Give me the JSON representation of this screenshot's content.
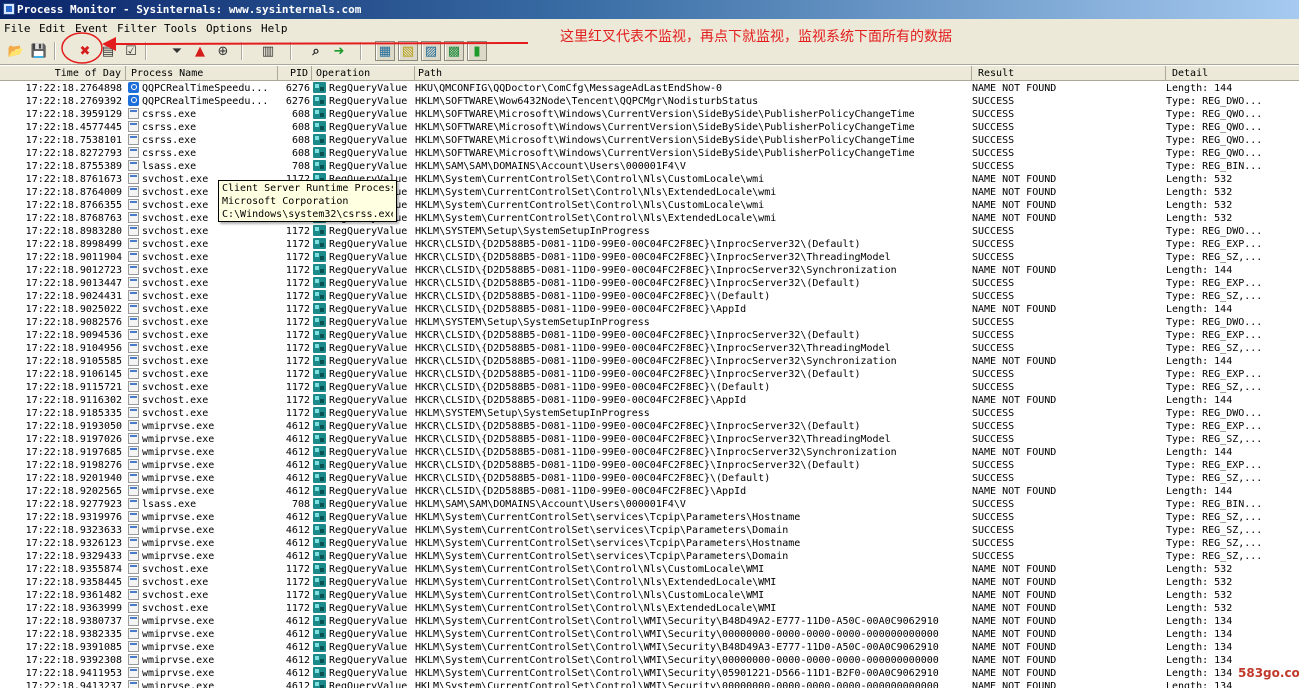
{
  "window": {
    "title": "Process Monitor - Sysinternals: www.sysinternals.com"
  },
  "menu": [
    "File",
    "Edit",
    "Event",
    "Filter",
    "Tools",
    "Options",
    "Help"
  ],
  "toolbar": {
    "buttons": [
      {
        "name": "open-icon",
        "glyph": "📂"
      },
      {
        "name": "save-icon",
        "glyph": "💾"
      },
      {
        "name": "capture-icon",
        "glyph": "✖"
      },
      {
        "name": "autoscroll-icon",
        "glyph": "▤"
      },
      {
        "name": "clear-icon",
        "glyph": "☑"
      },
      {
        "name": "filter-icon",
        "glyph": "⏷"
      },
      {
        "name": "highlight-icon",
        "glyph": "▲"
      },
      {
        "name": "network-icon",
        "glyph": "⊕"
      },
      {
        "name": "properties-icon",
        "glyph": "▥"
      },
      {
        "name": "find-icon",
        "glyph": "⌕"
      },
      {
        "name": "jump-icon",
        "glyph": "➜"
      },
      {
        "name": "registry-activity-icon",
        "glyph": "▦"
      },
      {
        "name": "file-activity-icon",
        "glyph": "▧"
      },
      {
        "name": "network-activity-icon",
        "glyph": "▨"
      },
      {
        "name": "process-activity-icon",
        "glyph": "▩"
      },
      {
        "name": "profiling-activity-icon",
        "glyph": "▮"
      }
    ]
  },
  "annotation": {
    "text": "这里红叉代表不监视，再点下就监视，监视系统下面所有的数据",
    "color": "#e31d1d"
  },
  "columns": {
    "time": "Time of Day",
    "process": "Process Name",
    "pid": "PID",
    "operation": "Operation",
    "path": "Path",
    "result": "Result",
    "detail": "Detail"
  },
  "rows": [
    {
      "time": "17:22:18.2764898",
      "proc": "QQPCRealTimeSpeedu...",
      "icon": "qq",
      "pid": "6276",
      "op": "RegQueryValue",
      "path": "HKU\\QMCONFIG\\QQDoctor\\ComCfg\\MessageAdLastEndShow-0",
      "result": "NAME NOT FOUND",
      "detail": "Length: 144"
    },
    {
      "time": "17:22:18.2769392",
      "proc": "QQPCRealTimeSpeedu...",
      "icon": "qq",
      "pid": "6276",
      "op": "RegQueryValue",
      "path": "HKLM\\SOFTWARE\\Wow6432Node\\Tencent\\QQPCMgr\\NodisturbStatus",
      "result": "SUCCESS",
      "detail": "Type: REG_DWO..."
    },
    {
      "time": "17:22:18.3959129",
      "proc": "csrss.exe",
      "icon": "gen",
      "pid": "608",
      "op": "RegQueryValue",
      "path": "HKLM\\SOFTWARE\\Microsoft\\Windows\\CurrentVersion\\SideBySide\\PublisherPolicyChangeTime",
      "result": "SUCCESS",
      "detail": "Type: REG_QWO..."
    },
    {
      "time": "17:22:18.4577445",
      "proc": "csrss.exe",
      "icon": "gen",
      "pid": "608",
      "op": "RegQueryValue",
      "path": "HKLM\\SOFTWARE\\Microsoft\\Windows\\CurrentVersion\\SideBySide\\PublisherPolicyChangeTime",
      "result": "SUCCESS",
      "detail": "Type: REG_QWO..."
    },
    {
      "time": "17:22:18.7538101",
      "proc": "csrss.exe",
      "icon": "gen",
      "pid": "608",
      "op": "RegQueryValue",
      "path": "HKLM\\SOFTWARE\\Microsoft\\Windows\\CurrentVersion\\SideBySide\\PublisherPolicyChangeTime",
      "result": "SUCCESS",
      "detail": "Type: REG_QWO..."
    },
    {
      "time": "17:22:18.8272793",
      "proc": "csrss.exe",
      "icon": "gen",
      "pid": "608",
      "op": "RegQueryValue",
      "path": "HKLM\\SOFTWARE\\Microsoft\\Windows\\CurrentVersion\\SideBySide\\PublisherPolicyChangeTime",
      "result": "SUCCESS",
      "detail": "Type: REG_QWO..."
    },
    {
      "time": "17:22:18.8755389",
      "proc": "lsass.exe",
      "icon": "gen",
      "pid": "708",
      "op": "RegQueryValue",
      "path": "HKLM\\SAM\\SAM\\DOMAINS\\Account\\Users\\000001F4\\V",
      "result": "SUCCESS",
      "detail": "Type: REG_BIN..."
    },
    {
      "time": "17:22:18.8761673",
      "proc": "svchost.exe",
      "icon": "gen",
      "pid": "1172",
      "op": "RegQueryValue",
      "path": "HKLM\\System\\CurrentControlSet\\Control\\Nls\\CustomLocale\\wmi",
      "result": "NAME NOT FOUND",
      "detail": "Length: 532"
    },
    {
      "time": "17:22:18.8764009",
      "proc": "svchost.exe",
      "icon": "gen",
      "pid": "1172",
      "op": "RegQueryValue",
      "path": "HKLM\\System\\CurrentControlSet\\Control\\Nls\\ExtendedLocale\\wmi",
      "result": "NAME NOT FOUND",
      "detail": "Length: 532"
    },
    {
      "time": "17:22:18.8766355",
      "proc": "svchost.exe",
      "icon": "gen",
      "pid": "1172",
      "op": "RegQueryValue",
      "path": "HKLM\\System\\CurrentControlSet\\Control\\Nls\\CustomLocale\\wmi",
      "result": "NAME NOT FOUND",
      "detail": "Length: 532"
    },
    {
      "time": "17:22:18.8768763",
      "proc": "svchost.exe",
      "icon": "gen",
      "pid": "1172",
      "op": "RegQueryValue",
      "path": "HKLM\\System\\CurrentControlSet\\Control\\Nls\\ExtendedLocale\\wmi",
      "result": "NAME NOT FOUND",
      "detail": "Length: 532"
    },
    {
      "time": "17:22:18.8983280",
      "proc": "svchost.exe",
      "icon": "gen",
      "pid": "1172",
      "op": "RegQueryValue",
      "path": "HKLM\\SYSTEM\\Setup\\SystemSetupInProgress",
      "result": "SUCCESS",
      "detail": "Type: REG_DWO..."
    },
    {
      "time": "17:22:18.8998499",
      "proc": "svchost.exe",
      "icon": "gen",
      "pid": "1172",
      "op": "RegQueryValue",
      "path": "HKCR\\CLSID\\{D2D588B5-D081-11D0-99E0-00C04FC2F8EC}\\InprocServer32\\(Default)",
      "result": "SUCCESS",
      "detail": "Type: REG_EXP..."
    },
    {
      "time": "17:22:18.9011904",
      "proc": "svchost.exe",
      "icon": "gen",
      "pid": "1172",
      "op": "RegQueryValue",
      "path": "HKCR\\CLSID\\{D2D588B5-D081-11D0-99E0-00C04FC2F8EC}\\InprocServer32\\ThreadingModel",
      "result": "SUCCESS",
      "detail": "Type: REG_SZ,..."
    },
    {
      "time": "17:22:18.9012723",
      "proc": "svchost.exe",
      "icon": "gen",
      "pid": "1172",
      "op": "RegQueryValue",
      "path": "HKCR\\CLSID\\{D2D588B5-D081-11D0-99E0-00C04FC2F8EC}\\InprocServer32\\Synchronization",
      "result": "NAME NOT FOUND",
      "detail": "Length: 144"
    },
    {
      "time": "17:22:18.9013447",
      "proc": "svchost.exe",
      "icon": "gen",
      "pid": "1172",
      "op": "RegQueryValue",
      "path": "HKCR\\CLSID\\{D2D588B5-D081-11D0-99E0-00C04FC2F8EC}\\InprocServer32\\(Default)",
      "result": "SUCCESS",
      "detail": "Type: REG_EXP..."
    },
    {
      "time": "17:22:18.9024431",
      "proc": "svchost.exe",
      "icon": "gen",
      "pid": "1172",
      "op": "RegQueryValue",
      "path": "HKCR\\CLSID\\{D2D588B5-D081-11D0-99E0-00C04FC2F8EC}\\(Default)",
      "result": "SUCCESS",
      "detail": "Type: REG_SZ,..."
    },
    {
      "time": "17:22:18.9025022",
      "proc": "svchost.exe",
      "icon": "gen",
      "pid": "1172",
      "op": "RegQueryValue",
      "path": "HKCR\\CLSID\\{D2D588B5-D081-11D0-99E0-00C04FC2F8EC}\\AppId",
      "result": "NAME NOT FOUND",
      "detail": "Length: 144"
    },
    {
      "time": "17:22:18.9082576",
      "proc": "svchost.exe",
      "icon": "gen",
      "pid": "1172",
      "op": "RegQueryValue",
      "path": "HKLM\\SYSTEM\\Setup\\SystemSetupInProgress",
      "result": "SUCCESS",
      "detail": "Type: REG_DWO..."
    },
    {
      "time": "17:22:18.9094536",
      "proc": "svchost.exe",
      "icon": "gen",
      "pid": "1172",
      "op": "RegQueryValue",
      "path": "HKCR\\CLSID\\{D2D588B5-D081-11D0-99E0-00C04FC2F8EC}\\InprocServer32\\(Default)",
      "result": "SUCCESS",
      "detail": "Type: REG_EXP..."
    },
    {
      "time": "17:22:18.9104956",
      "proc": "svchost.exe",
      "icon": "gen",
      "pid": "1172",
      "op": "RegQueryValue",
      "path": "HKCR\\CLSID\\{D2D588B5-D081-11D0-99E0-00C04FC2F8EC}\\InprocServer32\\ThreadingModel",
      "result": "SUCCESS",
      "detail": "Type: REG_SZ,..."
    },
    {
      "time": "17:22:18.9105585",
      "proc": "svchost.exe",
      "icon": "gen",
      "pid": "1172",
      "op": "RegQueryValue",
      "path": "HKCR\\CLSID\\{D2D588B5-D081-11D0-99E0-00C04FC2F8EC}\\InprocServer32\\Synchronization",
      "result": "NAME NOT FOUND",
      "detail": "Length: 144"
    },
    {
      "time": "17:22:18.9106145",
      "proc": "svchost.exe",
      "icon": "gen",
      "pid": "1172",
      "op": "RegQueryValue",
      "path": "HKCR\\CLSID\\{D2D588B5-D081-11D0-99E0-00C04FC2F8EC}\\InprocServer32\\(Default)",
      "result": "SUCCESS",
      "detail": "Type: REG_EXP..."
    },
    {
      "time": "17:22:18.9115721",
      "proc": "svchost.exe",
      "icon": "gen",
      "pid": "1172",
      "op": "RegQueryValue",
      "path": "HKCR\\CLSID\\{D2D588B5-D081-11D0-99E0-00C04FC2F8EC}\\(Default)",
      "result": "SUCCESS",
      "detail": "Type: REG_SZ,..."
    },
    {
      "time": "17:22:18.9116302",
      "proc": "svchost.exe",
      "icon": "gen",
      "pid": "1172",
      "op": "RegQueryValue",
      "path": "HKCR\\CLSID\\{D2D588B5-D081-11D0-99E0-00C04FC2F8EC}\\AppId",
      "result": "NAME NOT FOUND",
      "detail": "Length: 144"
    },
    {
      "time": "17:22:18.9185335",
      "proc": "svchost.exe",
      "icon": "gen",
      "pid": "1172",
      "op": "RegQueryValue",
      "path": "HKLM\\SYSTEM\\Setup\\SystemSetupInProgress",
      "result": "SUCCESS",
      "detail": "Type: REG_DWO..."
    },
    {
      "time": "17:22:18.9193050",
      "proc": "wmiprvse.exe",
      "icon": "gen",
      "pid": "4612",
      "op": "RegQueryValue",
      "path": "HKCR\\CLSID\\{D2D588B5-D081-11D0-99E0-00C04FC2F8EC}\\InprocServer32\\(Default)",
      "result": "SUCCESS",
      "detail": "Type: REG_EXP..."
    },
    {
      "time": "17:22:18.9197026",
      "proc": "wmiprvse.exe",
      "icon": "gen",
      "pid": "4612",
      "op": "RegQueryValue",
      "path": "HKCR\\CLSID\\{D2D588B5-D081-11D0-99E0-00C04FC2F8EC}\\InprocServer32\\ThreadingModel",
      "result": "SUCCESS",
      "detail": "Type: REG_SZ,..."
    },
    {
      "time": "17:22:18.9197685",
      "proc": "wmiprvse.exe",
      "icon": "gen",
      "pid": "4612",
      "op": "RegQueryValue",
      "path": "HKCR\\CLSID\\{D2D588B5-D081-11D0-99E0-00C04FC2F8EC}\\InprocServer32\\Synchronization",
      "result": "NAME NOT FOUND",
      "detail": "Length: 144"
    },
    {
      "time": "17:22:18.9198276",
      "proc": "wmiprvse.exe",
      "icon": "gen",
      "pid": "4612",
      "op": "RegQueryValue",
      "path": "HKCR\\CLSID\\{D2D588B5-D081-11D0-99E0-00C04FC2F8EC}\\InprocServer32\\(Default)",
      "result": "SUCCESS",
      "detail": "Type: REG_EXP..."
    },
    {
      "time": "17:22:18.9201940",
      "proc": "wmiprvse.exe",
      "icon": "gen",
      "pid": "4612",
      "op": "RegQueryValue",
      "path": "HKCR\\CLSID\\{D2D588B5-D081-11D0-99E0-00C04FC2F8EC}\\(Default)",
      "result": "SUCCESS",
      "detail": "Type: REG_SZ,..."
    },
    {
      "time": "17:22:18.9202565",
      "proc": "wmiprvse.exe",
      "icon": "gen",
      "pid": "4612",
      "op": "RegQueryValue",
      "path": "HKCR\\CLSID\\{D2D588B5-D081-11D0-99E0-00C04FC2F8EC}\\AppId",
      "result": "NAME NOT FOUND",
      "detail": "Length: 144"
    },
    {
      "time": "17:22:18.9277923",
      "proc": "lsass.exe",
      "icon": "gen",
      "pid": "708",
      "op": "RegQueryValue",
      "path": "HKLM\\SAM\\SAM\\DOMAINS\\Account\\Users\\000001F4\\V",
      "result": "SUCCESS",
      "detail": "Type: REG_BIN..."
    },
    {
      "time": "17:22:18.9319976",
      "proc": "wmiprvse.exe",
      "icon": "gen",
      "pid": "4612",
      "op": "RegQueryValue",
      "path": "HKLM\\System\\CurrentControlSet\\services\\Tcpip\\Parameters\\Hostname",
      "result": "SUCCESS",
      "detail": "Type: REG_SZ,..."
    },
    {
      "time": "17:22:18.9323633",
      "proc": "wmiprvse.exe",
      "icon": "gen",
      "pid": "4612",
      "op": "RegQueryValue",
      "path": "HKLM\\System\\CurrentControlSet\\services\\Tcpip\\Parameters\\Domain",
      "result": "SUCCESS",
      "detail": "Type: REG_SZ,..."
    },
    {
      "time": "17:22:18.9326123",
      "proc": "wmiprvse.exe",
      "icon": "gen",
      "pid": "4612",
      "op": "RegQueryValue",
      "path": "HKLM\\System\\CurrentControlSet\\services\\Tcpip\\Parameters\\Hostname",
      "result": "SUCCESS",
      "detail": "Type: REG_SZ,..."
    },
    {
      "time": "17:22:18.9329433",
      "proc": "wmiprvse.exe",
      "icon": "gen",
      "pid": "4612",
      "op": "RegQueryValue",
      "path": "HKLM\\System\\CurrentControlSet\\services\\Tcpip\\Parameters\\Domain",
      "result": "SUCCESS",
      "detail": "Type: REG_SZ,..."
    },
    {
      "time": "17:22:18.9355874",
      "proc": "svchost.exe",
      "icon": "gen",
      "pid": "1172",
      "op": "RegQueryValue",
      "path": "HKLM\\System\\CurrentControlSet\\Control\\Nls\\CustomLocale\\WMI",
      "result": "NAME NOT FOUND",
      "detail": "Length: 532"
    },
    {
      "time": "17:22:18.9358445",
      "proc": "svchost.exe",
      "icon": "gen",
      "pid": "1172",
      "op": "RegQueryValue",
      "path": "HKLM\\System\\CurrentControlSet\\Control\\Nls\\ExtendedLocale\\WMI",
      "result": "NAME NOT FOUND",
      "detail": "Length: 532"
    },
    {
      "time": "17:22:18.9361482",
      "proc": "svchost.exe",
      "icon": "gen",
      "pid": "1172",
      "op": "RegQueryValue",
      "path": "HKLM\\System\\CurrentControlSet\\Control\\Nls\\CustomLocale\\WMI",
      "result": "NAME NOT FOUND",
      "detail": "Length: 532"
    },
    {
      "time": "17:22:18.9363999",
      "proc": "svchost.exe",
      "icon": "gen",
      "pid": "1172",
      "op": "RegQueryValue",
      "path": "HKLM\\System\\CurrentControlSet\\Control\\Nls\\ExtendedLocale\\WMI",
      "result": "NAME NOT FOUND",
      "detail": "Length: 532"
    },
    {
      "time": "17:22:18.9380737",
      "proc": "wmiprvse.exe",
      "icon": "gen",
      "pid": "4612",
      "op": "RegQueryValue",
      "path": "HKLM\\System\\CurrentControlSet\\Control\\WMI\\Security\\B48D49A2-E777-11D0-A50C-00A0C9062910",
      "result": "NAME NOT FOUND",
      "detail": "Length: 134"
    },
    {
      "time": "17:22:18.9382335",
      "proc": "wmiprvse.exe",
      "icon": "gen",
      "pid": "4612",
      "op": "RegQueryValue",
      "path": "HKLM\\System\\CurrentControlSet\\Control\\WMI\\Security\\00000000-0000-0000-0000-000000000000",
      "result": "NAME NOT FOUND",
      "detail": "Length: 134"
    },
    {
      "time": "17:22:18.9391085",
      "proc": "wmiprvse.exe",
      "icon": "gen",
      "pid": "4612",
      "op": "RegQueryValue",
      "path": "HKLM\\System\\CurrentControlSet\\Control\\WMI\\Security\\B48D49A3-E777-11D0-A50C-00A0C9062910",
      "result": "NAME NOT FOUND",
      "detail": "Length: 134"
    },
    {
      "time": "17:22:18.9392308",
      "proc": "wmiprvse.exe",
      "icon": "gen",
      "pid": "4612",
      "op": "RegQueryValue",
      "path": "HKLM\\System\\CurrentControlSet\\Control\\WMI\\Security\\00000000-0000-0000-0000-000000000000",
      "result": "NAME NOT FOUND",
      "detail": "Length: 134"
    },
    {
      "time": "17:22:18.9411953",
      "proc": "wmiprvse.exe",
      "icon": "gen",
      "pid": "4612",
      "op": "RegQueryValue",
      "path": "HKLM\\System\\CurrentControlSet\\Control\\WMI\\Security\\05901221-D566-11D1-B2F0-00A0C9062910",
      "result": "NAME NOT FOUND",
      "detail": "Length: 134"
    },
    {
      "time": "17:22:18.9413237",
      "proc": "wmiprvse.exe",
      "icon": "gen",
      "pid": "4612",
      "op": "RegQueryValue",
      "path": "HKLM\\System\\CurrentControlSet\\Control\\WMI\\Security\\00000000-0000-0000-0000-000000000000",
      "result": "NAME NOT FOUND",
      "detail": "Length: 134"
    }
  ],
  "tooltip": {
    "lines": [
      "Client Server Runtime Process",
      "Microsoft Corporation",
      "C:\\Windows\\system32\\csrss.exe"
    ]
  },
  "watermark": "583go.com"
}
